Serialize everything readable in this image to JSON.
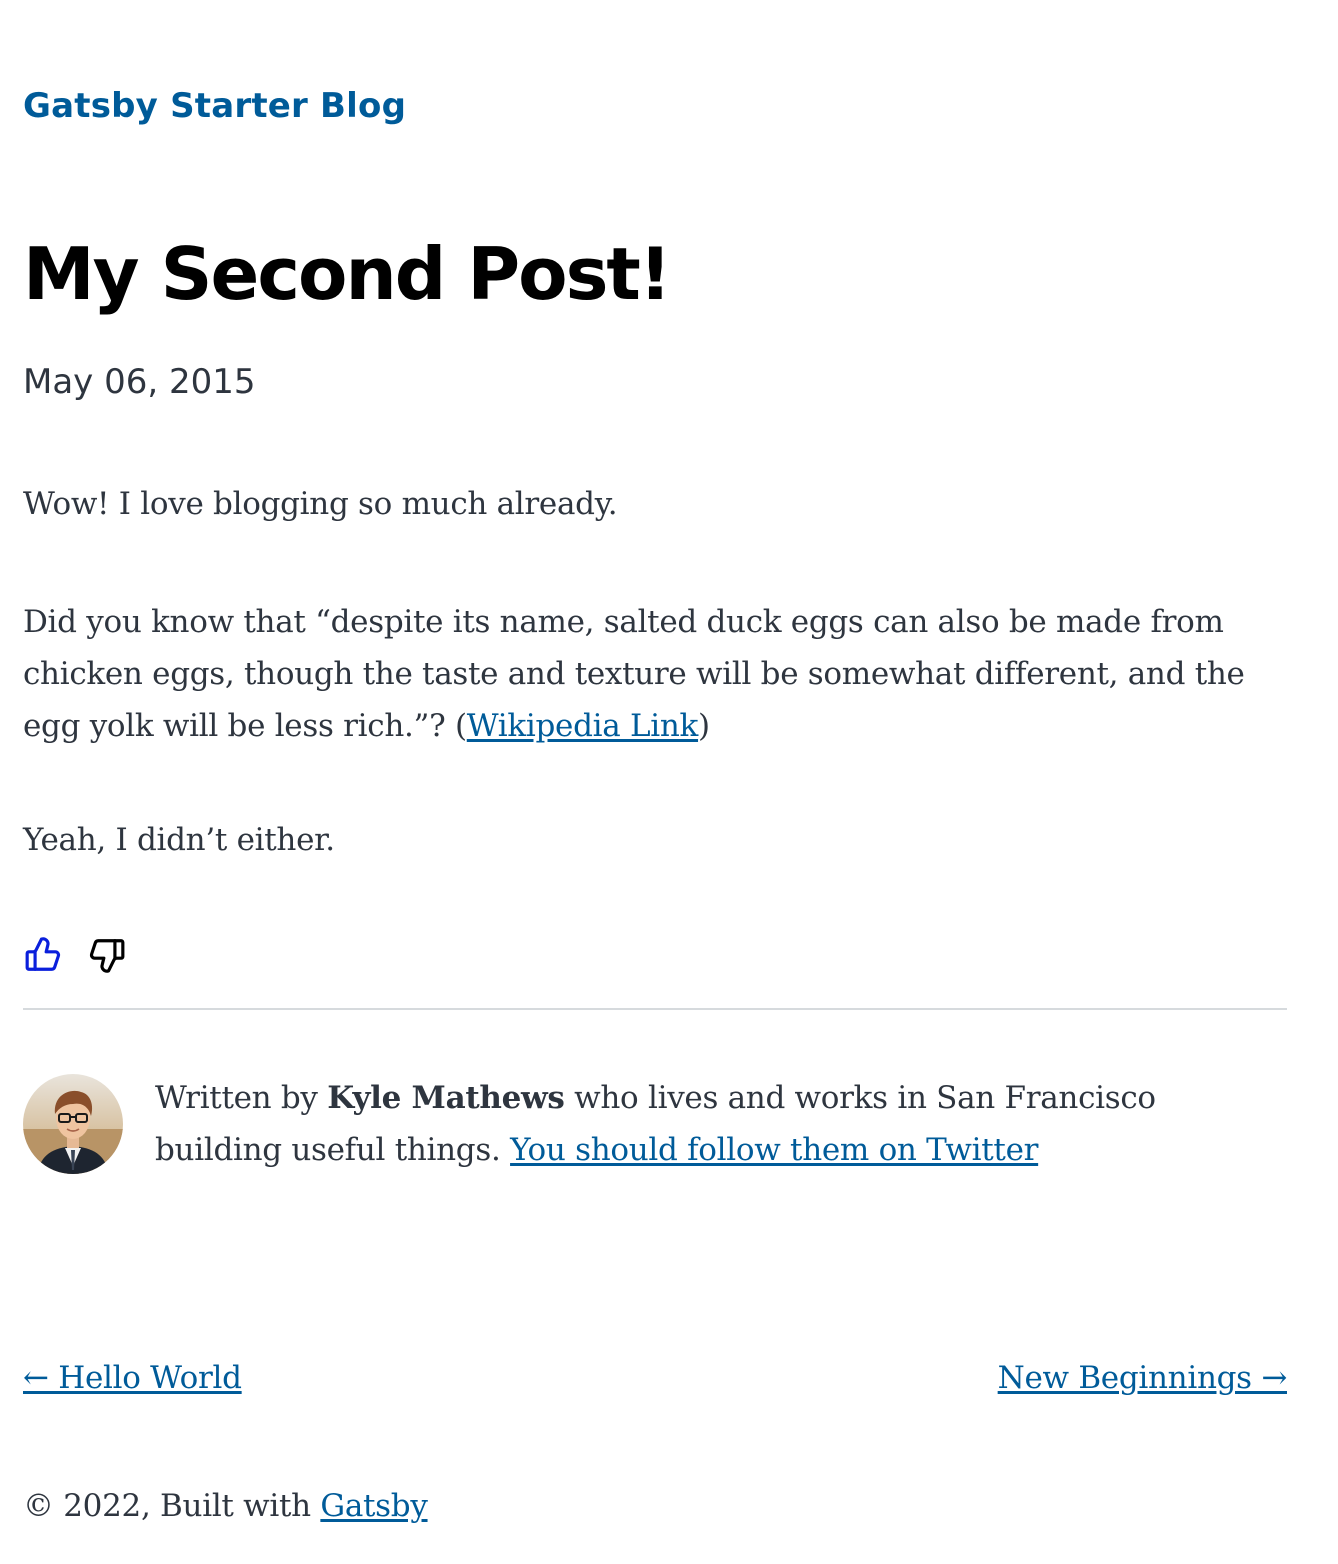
{
  "header": {
    "site_title": "Gatsby Starter Blog"
  },
  "post": {
    "title": "My Second Post!",
    "date": "May 06, 2015",
    "paragraph1": "Wow! I love blogging so much already.",
    "paragraph2_text": "Did you know that “despite its name, salted duck eggs can also be made from chicken eggs, though the taste and texture will be somewhat different, and the egg yolk will be less rich.”? (",
    "paragraph2_link": "Wikipedia Link",
    "paragraph2_close": ")",
    "paragraph3": "Yeah, I didn’t either."
  },
  "reactions": {
    "like_icon": "thumbs-up-icon",
    "dislike_icon": "thumbs-down-icon",
    "like_color": "#0a1fdc",
    "dislike_color": "#000000"
  },
  "bio": {
    "prefix": "Written by ",
    "author": "Kyle Mathews",
    "suffix": " who lives and works in San Francisco building useful things. ",
    "twitter_link": "You should follow them on Twitter"
  },
  "post_nav": {
    "previous": "← Hello World",
    "next": "New Beginnings →"
  },
  "footer": {
    "prefix": "© 2022, Built with ",
    "link": "Gatsby"
  },
  "colors": {
    "accent": "#005b99",
    "text": "#2e353f",
    "divider": "#d6dadd"
  }
}
